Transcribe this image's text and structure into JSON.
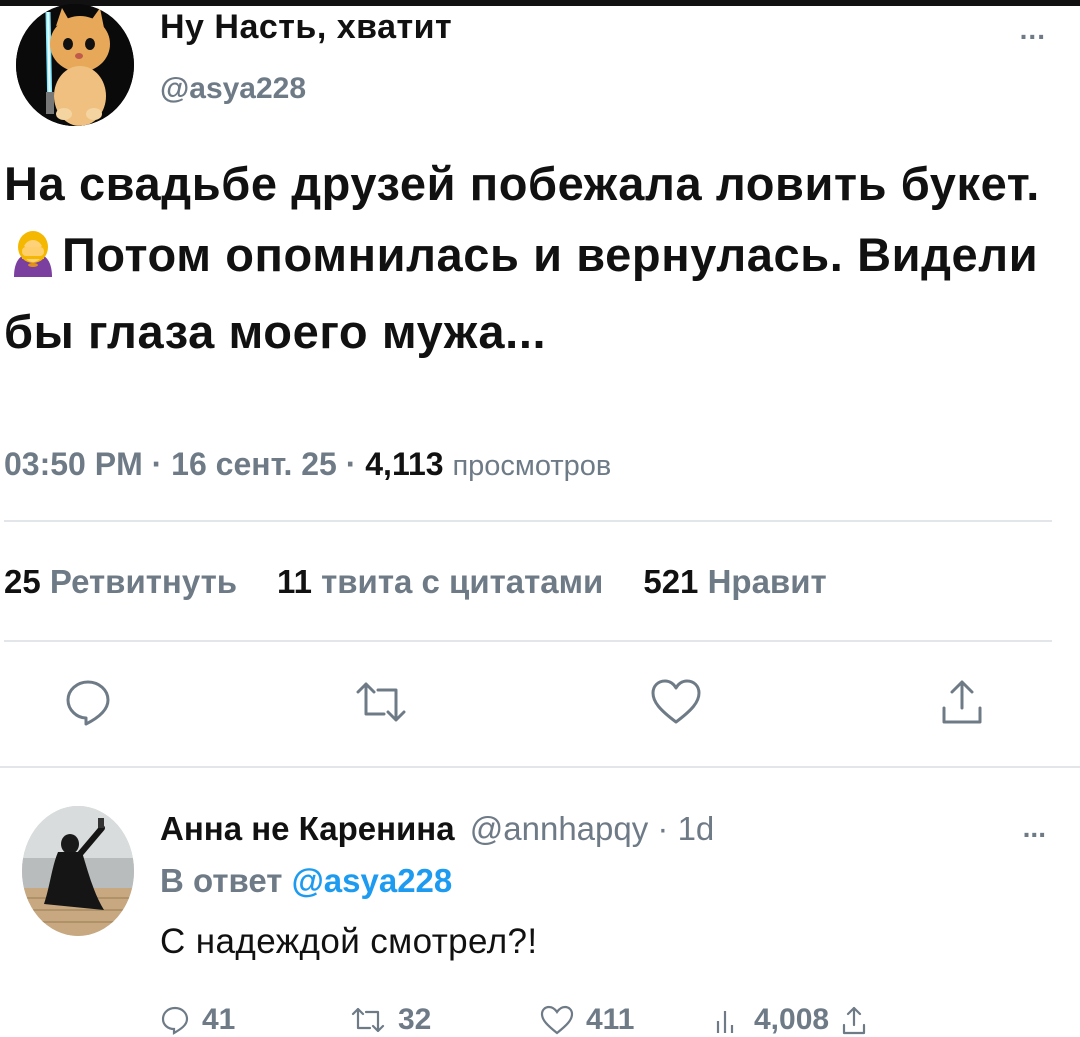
{
  "tweet": {
    "author": {
      "name": "Ну Насть, хватит",
      "handle": "@asya228"
    },
    "more_label": "...",
    "text_part1": "На свадьбе друзей побежала ловить букет.",
    "emoji_icon": "woman-facepalming-emoji",
    "text_part2": "Потом опомнилась и вернулась. Видели бы глаза моего мужа...",
    "meta": {
      "time": "03:50 PM",
      "separator": "·",
      "date": "16 сент. 25",
      "views_count": "4,113",
      "views_label": "просмотров"
    },
    "stats": {
      "retweets_count": "25",
      "retweets_label": "Ретвитнуть",
      "quotes_count": "11",
      "quotes_label": "твита с цитатами",
      "likes_count": "521",
      "likes_label": "Нравит"
    },
    "actions": [
      "reply-icon",
      "retweet-icon",
      "like-icon",
      "share-icon"
    ]
  },
  "reply": {
    "author_name": "Анна не Каренина",
    "handle_time": "@annhapqy · 1d",
    "more_label": "...",
    "reply_to_label": "В ответ",
    "reply_to_handle": "@asya228",
    "text": "С надеждой смотрел?!",
    "actions": {
      "replies": "41",
      "retweets": "32",
      "likes": "411",
      "views": "4,008"
    }
  },
  "colors": {
    "text": "#111111",
    "muted": "#6e7b87",
    "link": "#1d9bf0",
    "divider": "#e3e6e9",
    "emoji_hair": "#f5b800",
    "emoji_top": "#7b3fa0"
  }
}
